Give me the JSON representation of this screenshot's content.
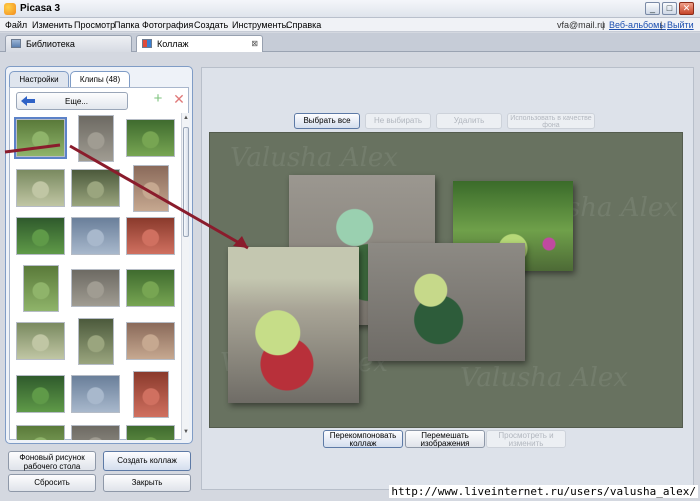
{
  "window": {
    "title": "Picasa 3"
  },
  "menu": [
    "Файл",
    "Изменить",
    "Просмотр",
    "Папка",
    "Фотография",
    "Создать",
    "Инструменты",
    "Справка"
  ],
  "account": {
    "email": "vfa@mail.ru",
    "separator": "|",
    "web_albums": "Веб-альбомы",
    "logout": "Выйти"
  },
  "tabs": [
    {
      "label": "Библиотека"
    },
    {
      "label": "Коллаж",
      "close": "⊠"
    }
  ],
  "side_panel": {
    "tabs": [
      "Настройки",
      "Клипы (48)"
    ],
    "more_label": "Еще...",
    "thumb_count": 27
  },
  "collage_toolbar": {
    "select_all": "Выбрать все",
    "deselect": "Не выбирать",
    "delete": "Удалить",
    "use_as_background": "Использовать в качестве фона"
  },
  "collage_bottom": {
    "rearrange": "Перекомпоновать коллаж",
    "shuffle": "Перемешать изображения",
    "view_edit": "Просмотреть и изменить"
  },
  "left_buttons": {
    "desktop_bg": "Фоновый рисунок рабочего стола",
    "create_collage": "Создать коллаж",
    "reset": "Сбросить",
    "close": "Закрыть"
  },
  "canvas": {
    "background_color": "#687260",
    "watermark": "Valusha Alex"
  },
  "status": {
    "url": "http://www.liveinternet.ru/users/valusha_alex/"
  }
}
